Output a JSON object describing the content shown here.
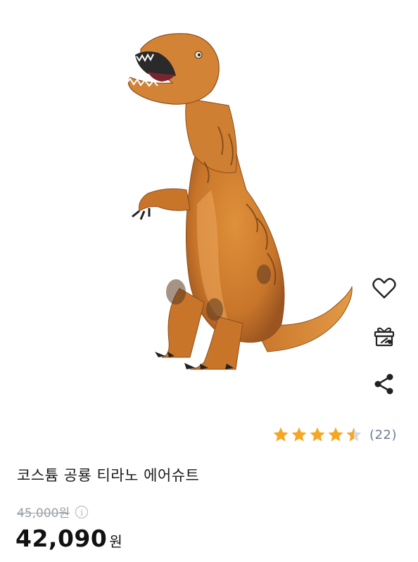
{
  "product": {
    "image_alt": "inflatable t-rex costume",
    "title": "코스튬 공룡 티라노 에어슈트",
    "original_price": "45,000원",
    "price_amount": "42,090",
    "price_unit": "원"
  },
  "rating": {
    "stars": 4.5,
    "count_label": "(22)",
    "star_color": "#f5a623"
  },
  "actions": {
    "icons": [
      "heart-icon",
      "gift-icon",
      "share-icon"
    ]
  }
}
